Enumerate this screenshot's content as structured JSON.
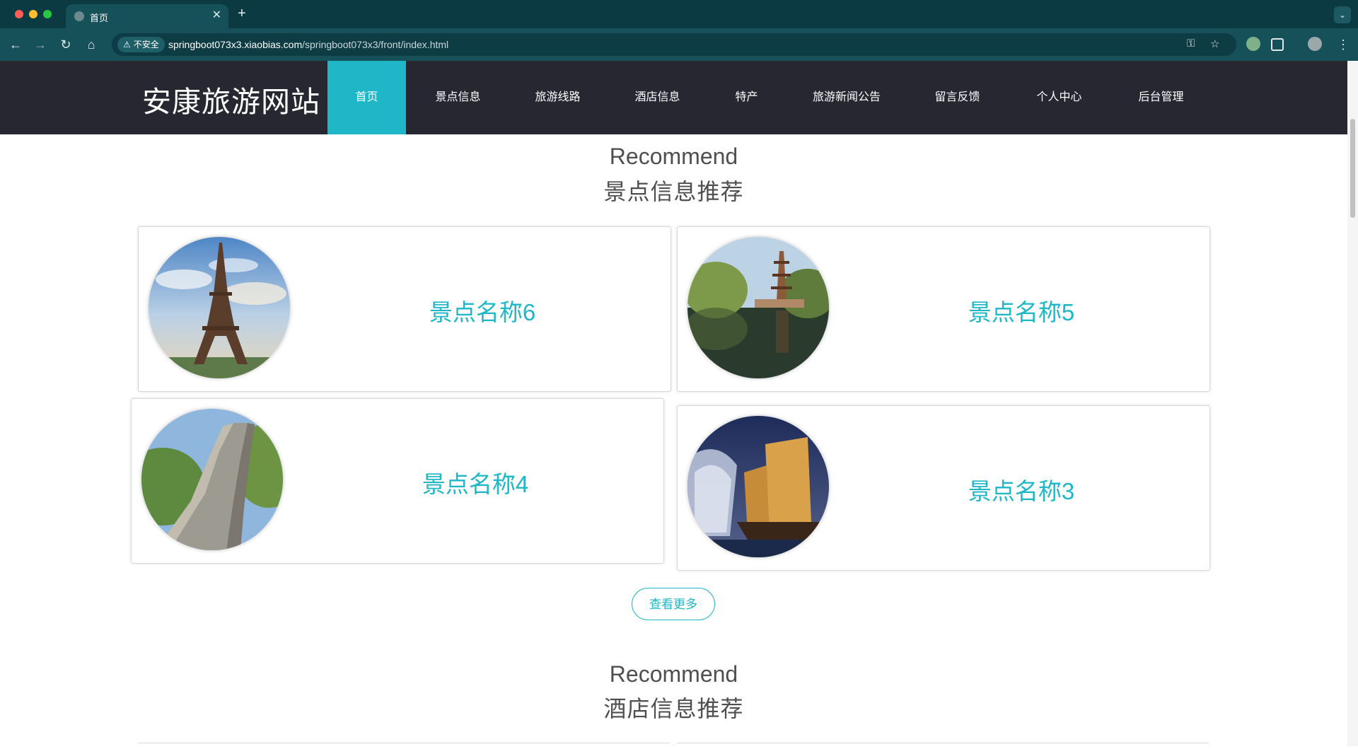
{
  "browser": {
    "tab_title": "首页",
    "tab_close": "✕",
    "new_tab": "+",
    "tab_menu": "⌄",
    "insecure_label": "不安全",
    "url_host": "springboot073x3.xiaobias.com",
    "url_path": "/springboot073x3/front/index.html",
    "back": "←",
    "forward": "→",
    "reload": "↻",
    "home": "⌂"
  },
  "site": {
    "title": "安康旅游网站",
    "nav": [
      {
        "label": "首页",
        "active": true
      },
      {
        "label": "景点信息"
      },
      {
        "label": "旅游线路"
      },
      {
        "label": "酒店信息"
      },
      {
        "label": "特产"
      },
      {
        "label": "旅游新闻公告"
      },
      {
        "label": "留言反馈"
      },
      {
        "label": "个人中心"
      },
      {
        "label": "后台管理"
      }
    ]
  },
  "sections": {
    "attractions": {
      "en": "Recommend",
      "cn": "景点信息推荐",
      "cards": [
        {
          "name": "景点名称6",
          "image": "eiffel-tower"
        },
        {
          "name": "景点名称5",
          "image": "pagoda-lake"
        },
        {
          "name": "景点名称4",
          "image": "great-wall"
        },
        {
          "name": "景点名称3",
          "image": "junk-boat"
        }
      ],
      "more_label": "查看更多"
    },
    "hotels": {
      "en": "Recommend",
      "cn": "酒店信息推荐"
    }
  },
  "colors": {
    "accent": "#1fb7c7",
    "header_bg": "#262730",
    "chrome_bg": "#165058"
  }
}
